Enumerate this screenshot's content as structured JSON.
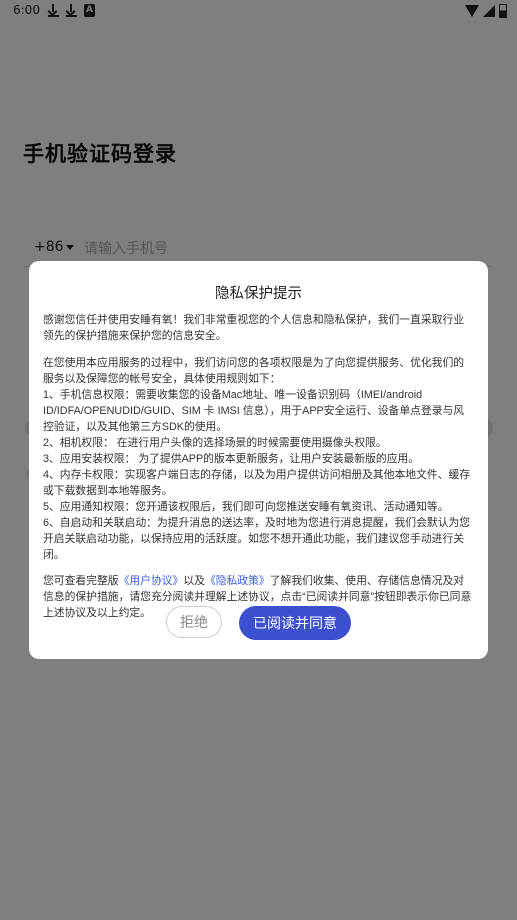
{
  "status_bar": {
    "time": "6:00",
    "app_icon_letter": "A"
  },
  "login": {
    "title": "手机验证码登录",
    "country_code": "+86",
    "phone_placeholder": "请输入手机号"
  },
  "dialog": {
    "title": "隐私保护提示",
    "intro": "感谢您信任并使用安睡有氧！我们非常重视您的个人信息和隐私保护，我们一直采取行业领先的保护措施来保护您的信息安全。",
    "rules_heading": "在您使用本应用服务的过程中，我们访问您的各项权限是为了向您提供服务、优化我们的服务以及保障您的帐号安全，具体使用规则如下：",
    "rules": [
      "1、手机信息权限：需要收集您的设备Mac地址、唯一设备识别码（IMEI/android ID/IDFA/OPENUDID/GUID、SIM 卡 IMSI 信息），用于APP安全运行、设备单点登录与风控验证，以及其他第三方SDK的使用。",
      "2、相机权限： 在进行用户头像的选择场景的时候需要使用摄像头权限。",
      "3、应用安装权限： 为了提供APP的版本更新服务，让用户安装最新版的应用。",
      "4、内存卡权限：实现客户端日志的存储，以及为用户提供访问相册及其他本地文件、缓存或下载数据到本地等服务。",
      "5、应用通知权限：您开通该权限后，我们即可向您推送安睡有氧资讯、活动通知等。",
      "6、自启动和关联启动：为提升消息的送达率，及时地为您进行消息提醒，我们会默认为您开启关联启动功能，以保持应用的活跃度。如您不想开通此功能，我们建议您手动进行关闭。"
    ],
    "outro_prefix": "您可查看完整版",
    "user_agreement_link": "《用户协议》",
    "outro_mid": "以及",
    "privacy_policy_link": "《隐私政策》",
    "outro_suffix": "了解我们收集、使用、存储信息情况及对信息的保护措施，请您充分阅读并理解上述协议，点击“已阅读并同意”按钮即表示你已同意上述协议及以上约定。",
    "reject_label": "拒绝",
    "agree_label": "已阅读并同意"
  },
  "colors": {
    "accent": "#3b4fcf",
    "link": "#3a5fd9"
  }
}
